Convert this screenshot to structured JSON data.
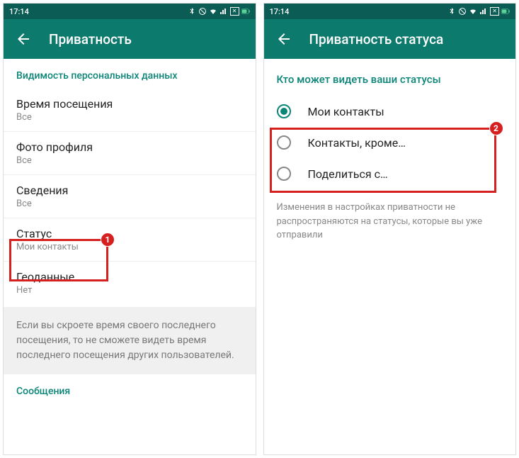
{
  "status": {
    "time": "17:14"
  },
  "left": {
    "title": "Приватность",
    "section_header": "Видимость персональных данных",
    "items": [
      {
        "title": "Время посещения",
        "value": "Все"
      },
      {
        "title": "Фото профиля",
        "value": "Все"
      },
      {
        "title": "Сведения",
        "value": "Все"
      },
      {
        "title": "Статус",
        "value": "Мои контакты"
      },
      {
        "title": "Геоданные",
        "value": "Нет"
      }
    ],
    "note": "Если вы скроете время своего последнего посещения, то не сможете видеть время последнего посещения других пользователей.",
    "next_section": "Сообщения"
  },
  "right": {
    "title": "Приватность статуса",
    "section_header": "Кто может видеть ваши статусы",
    "options": [
      {
        "label": "Мои контакты",
        "selected": true
      },
      {
        "label": "Контакты, кроме…",
        "selected": false
      },
      {
        "label": "Поделиться с…",
        "selected": false
      }
    ],
    "footnote": "Изменения в настройках приватности не распространяются на статусы, которые вы уже отправили"
  },
  "badges": {
    "b1": "1",
    "b2": "2"
  }
}
